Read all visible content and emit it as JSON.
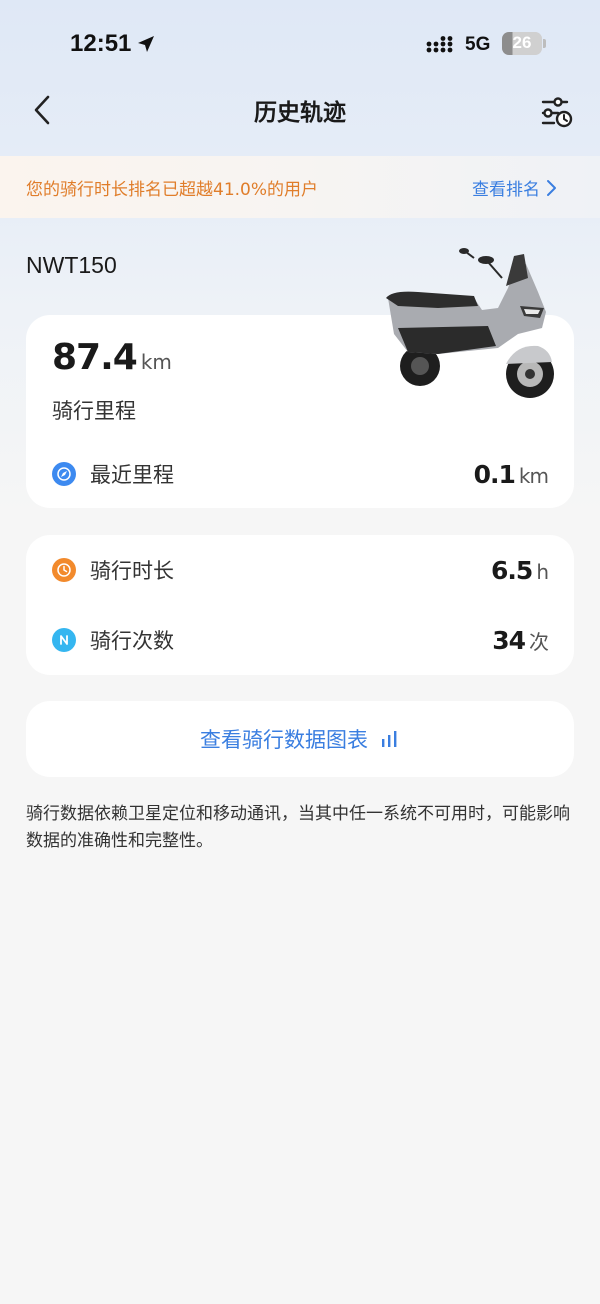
{
  "status_bar": {
    "time": "12:51",
    "network": "5G",
    "battery": "26"
  },
  "nav": {
    "title": "历史轨迹"
  },
  "ranking": {
    "text": "您的骑行时长排名已超越41.0%的用户",
    "link_label": "查看排名"
  },
  "vehicle": {
    "model": "NWT150"
  },
  "mileage": {
    "value": "87.4",
    "unit": "km",
    "label": "骑行里程",
    "recent_label": "最近里程",
    "recent_value": "0.1",
    "recent_unit": "km"
  },
  "stats": {
    "duration_label": "骑行时长",
    "duration_value": "6.5",
    "duration_unit": "h",
    "count_label": "骑行次数",
    "count_value": "34",
    "count_unit": "次"
  },
  "chart_button": {
    "label": "查看骑行数据图表"
  },
  "disclaimer": "骑行数据依赖卫星定位和移动通讯，当其中任一系统不可用时，可能影响数据的准确性和完整性。",
  "colors": {
    "accent_blue": "#3a7ee0",
    "accent_orange": "#e07d2a",
    "icon_blue": "#3d8af0",
    "icon_orange": "#f28a2c",
    "icon_cyan": "#35b6f0"
  }
}
